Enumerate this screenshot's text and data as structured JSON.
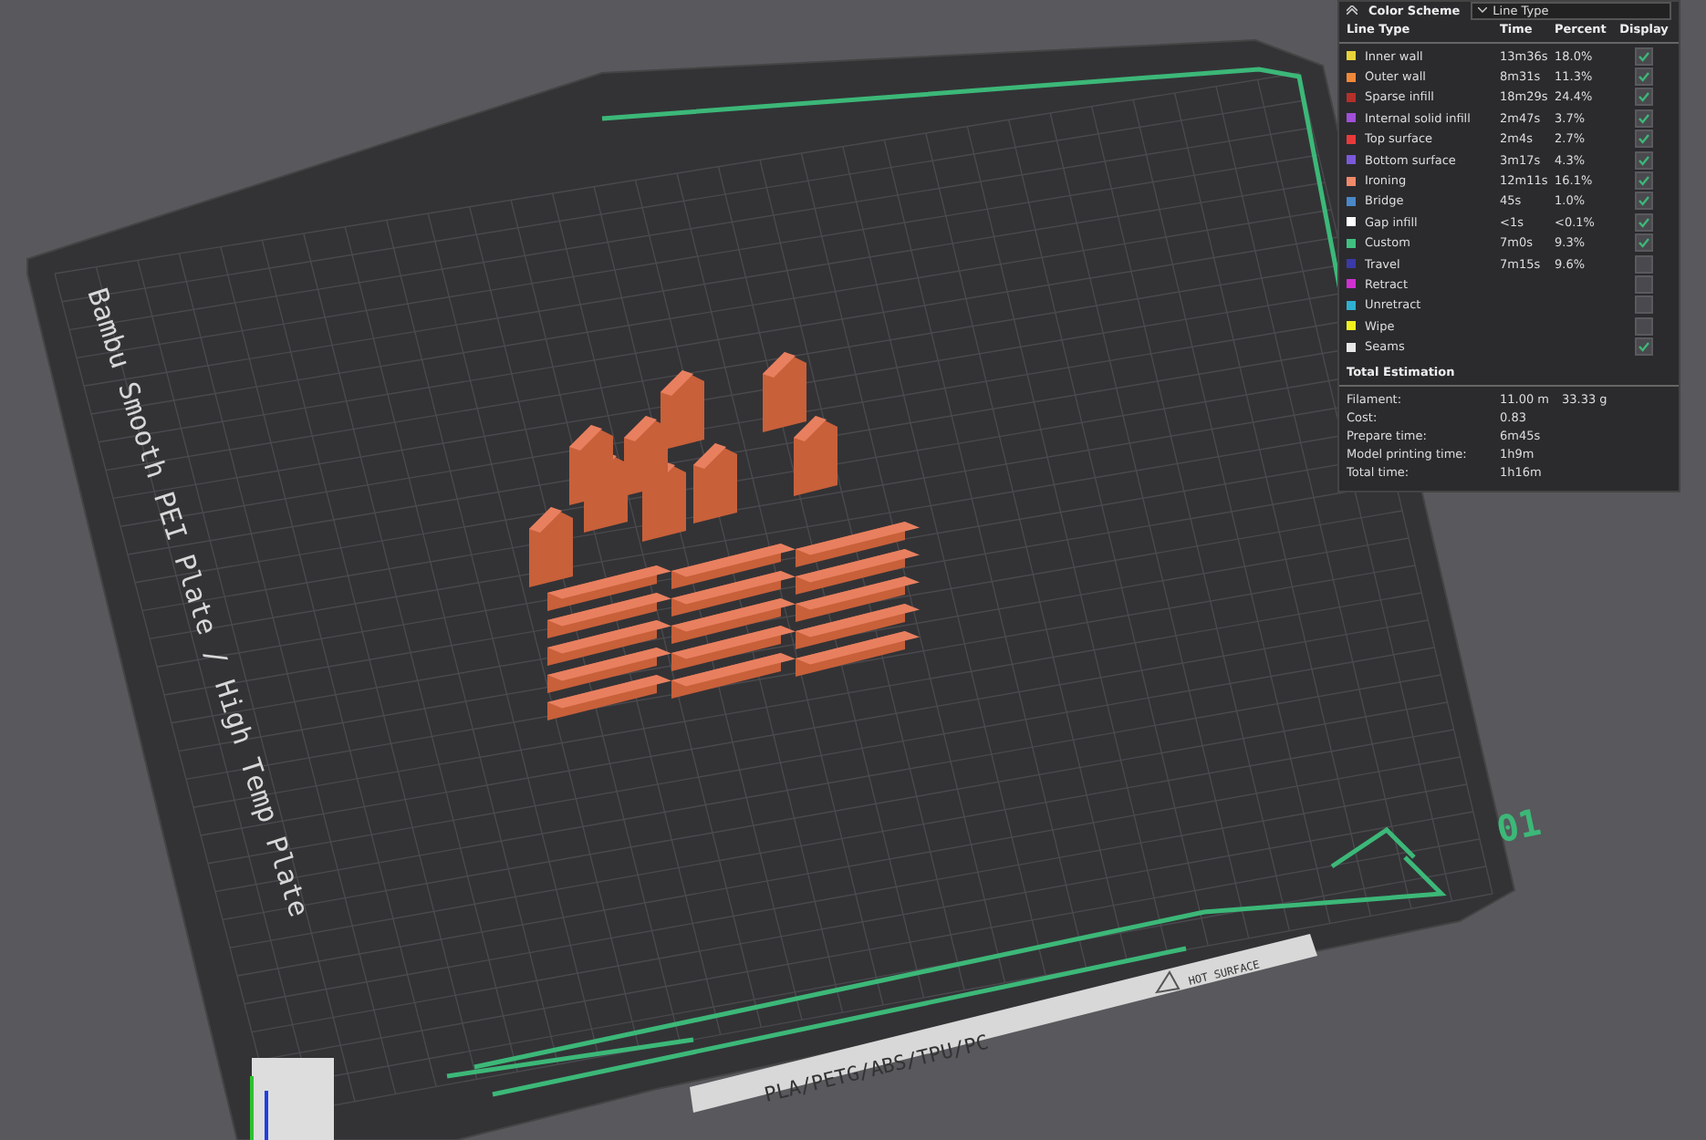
{
  "plate": {
    "name": "Bambu Smooth PEI Plate / High Temp Plate",
    "number": "01",
    "materials": "PLA/PETG/ABS/TPU/PC",
    "warning": "HOT SURFACE"
  },
  "legend": {
    "title": "Color Scheme",
    "scheme": "Line Type",
    "columns": [
      "Line Type",
      "Time",
      "Percent",
      "Display"
    ],
    "rows": [
      {
        "name": "Inner wall",
        "time": "13m36s",
        "percent": "18.0%",
        "color": "#e8d23a",
        "checked": true
      },
      {
        "name": "Outer wall",
        "time": "8m31s",
        "percent": "11.3%",
        "color": "#f0883a",
        "checked": true
      },
      {
        "name": "Sparse infill",
        "time": "18m29s",
        "percent": "24.4%",
        "color": "#b5302a",
        "checked": true
      },
      {
        "name": "Internal solid infill",
        "time": "2m47s",
        "percent": "3.7%",
        "color": "#a050d8",
        "checked": true
      },
      {
        "name": "Top surface",
        "time": "2m4s",
        "percent": "2.7%",
        "color": "#e83a3a",
        "checked": true
      },
      {
        "name": "Bottom surface",
        "time": "3m17s",
        "percent": "4.3%",
        "color": "#7a5ad8",
        "checked": true
      },
      {
        "name": "Ironing",
        "time": "12m11s",
        "percent": "16.1%",
        "color": "#f08a6a",
        "checked": true
      },
      {
        "name": "Bridge",
        "time": "45s",
        "percent": "1.0%",
        "color": "#4a88c8",
        "checked": true
      },
      {
        "name": "Gap infill",
        "time": "<1s",
        "percent": "<0.1%",
        "color": "#ffffff",
        "checked": true
      },
      {
        "name": "Custom",
        "time": "7m0s",
        "percent": "9.3%",
        "color": "#40c080",
        "checked": true
      },
      {
        "name": "Travel",
        "time": "7m15s",
        "percent": "9.6%",
        "color": "#3a3aa8",
        "checked": false
      },
      {
        "name": "Retract",
        "color": "#d030d0",
        "checked": false
      },
      {
        "name": "Unretract",
        "color": "#30b0d0",
        "checked": false
      },
      {
        "name": "Wipe",
        "color": "#f0f020",
        "checked": false
      },
      {
        "name": "Seams",
        "color": "#e8e8e8",
        "checked": true
      }
    ],
    "total_title": "Total Estimation",
    "totals": [
      {
        "label": "Filament:",
        "value": "11.00 m",
        "extra": "33.33 g"
      },
      {
        "label": "Cost:",
        "value": "0.83"
      },
      {
        "label": "Prepare time:",
        "value": "6m45s"
      },
      {
        "label": "Model printing time:",
        "value": "1h9m"
      },
      {
        "label": "Total time:",
        "value": "1h16m"
      }
    ]
  }
}
